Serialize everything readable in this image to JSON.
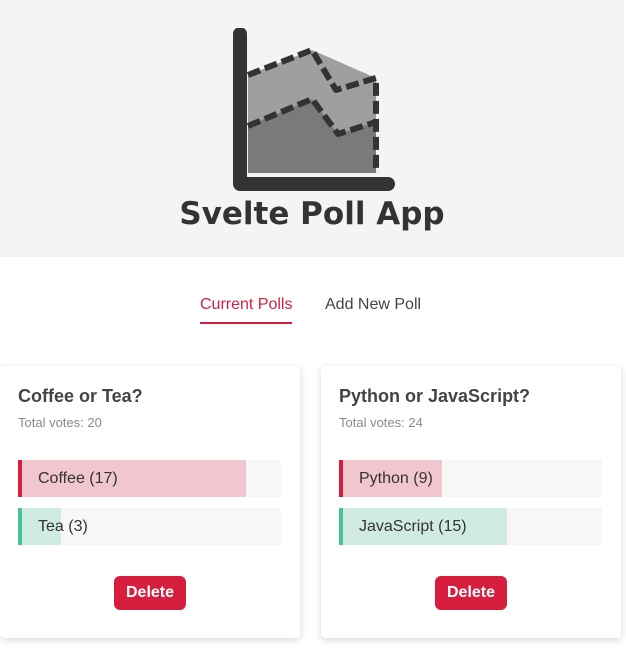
{
  "app": {
    "title": "Svelte Poll App"
  },
  "logo": {
    "icon": "area-chart-icon"
  },
  "tabs": [
    {
      "label": "Current Polls",
      "active": true
    },
    {
      "label": "Add New Poll",
      "active": false
    }
  ],
  "colors": {
    "accent": "#d81e3f",
    "answer_a_fill": "#f1c6cf",
    "answer_a_border": "#d81e3f",
    "answer_b_fill": "#d0ece1",
    "answer_b_border": "#45c496",
    "header_bg": "#f4f4f4"
  },
  "polls": [
    {
      "question": "Coffee or Tea?",
      "total_label": "Total votes: 20",
      "answers": [
        {
          "label": "Coffee (17)",
          "percent": 85
        },
        {
          "label": "Tea (3)",
          "percent": 15
        }
      ],
      "delete_label": "Delete"
    },
    {
      "question": "Python or JavaScript?",
      "total_label": "Total votes: 24",
      "answers": [
        {
          "label": "Python (9)",
          "percent": 37.5
        },
        {
          "label": "JavaScript (15)",
          "percent": 62.5
        }
      ],
      "delete_label": "Delete"
    }
  ]
}
